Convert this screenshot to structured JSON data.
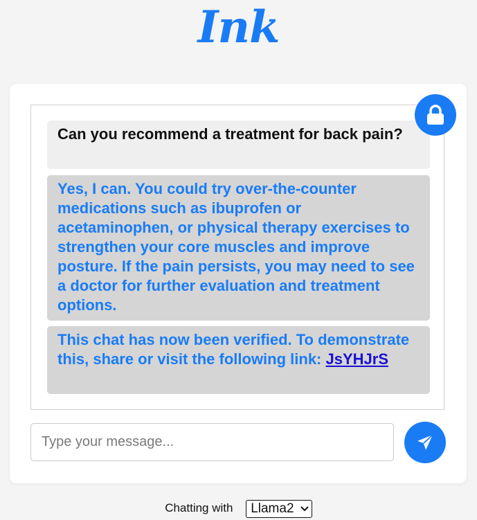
{
  "app": {
    "logo_text": "Ink",
    "accent_color": "#1a7cf5"
  },
  "chat": {
    "messages": [
      {
        "role": "user",
        "text": "Can you recommend a treatment for back pain?"
      },
      {
        "role": "assistant",
        "text": "Yes, I can. You could try over-the-counter medications such as ibuprofen or acetaminophen, or physical therapy exercises to strengthen your core muscles and improve posture. If the pain persists, you may need to see a doctor for further evaluation and treatment options."
      },
      {
        "role": "assistant",
        "text_prefix": "This chat has now been verified. To demonstrate this, share or visit the following link: ",
        "link_text": "JsYHJrS"
      }
    ],
    "lock_icon": "lock-icon"
  },
  "composer": {
    "placeholder": "Type your message...",
    "send_icon": "paper-plane-icon"
  },
  "footer": {
    "label": "Chatting with",
    "selected_model": "Llama2"
  }
}
